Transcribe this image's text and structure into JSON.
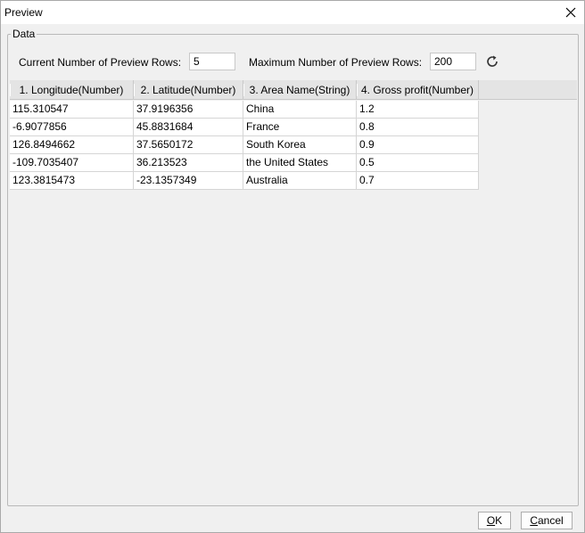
{
  "window": {
    "title": "Preview"
  },
  "data_group": {
    "legend": "Data"
  },
  "controls": {
    "current_rows_label": "Current Number of Preview Rows:",
    "current_rows_value": "5",
    "max_rows_label": "Maximum Number of Preview Rows:",
    "max_rows_value": "200"
  },
  "table": {
    "headers": [
      "1. Longitude(Number)",
      "2. Latitude(Number)",
      "3. Area Name(String)",
      "4. Gross profit(Number)"
    ],
    "rows": [
      [
        "115.310547",
        "37.9196356",
        "China",
        "1.2"
      ],
      [
        "-6.9077856",
        "45.8831684",
        "France",
        "0.8"
      ],
      [
        "126.8494662",
        "37.5650172",
        "South Korea",
        "0.9"
      ],
      [
        "-109.7035407",
        "36.213523",
        "the United States",
        "0.5"
      ],
      [
        "123.3815473",
        "-23.1357349",
        "Australia",
        "0.7"
      ]
    ]
  },
  "buttons": {
    "ok_mnemonic": "O",
    "ok_rest": "K",
    "cancel_mnemonic": "C",
    "cancel_rest": "ancel"
  }
}
